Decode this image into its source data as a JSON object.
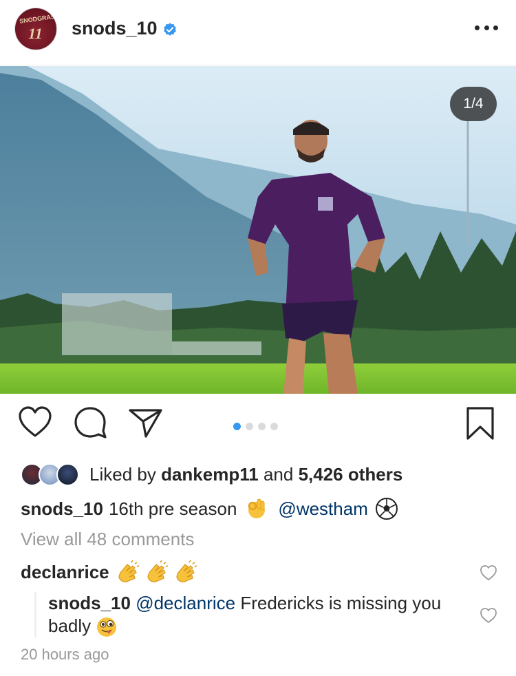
{
  "header": {
    "username": "snods_10",
    "avatar_shirt_text": "SNODGRASS",
    "avatar_shirt_number": "11",
    "verified_icon": "verified-badge-icon",
    "more_icon": "more-options-icon"
  },
  "photo": {
    "counter": "1/4"
  },
  "actions": {
    "like_icon": "heart-icon",
    "comment_icon": "comment-icon",
    "share_icon": "paper-plane-icon",
    "save_icon": "bookmark-icon",
    "carousel_total": 4,
    "carousel_active_index": 0
  },
  "likes": {
    "prefix": "Liked by",
    "first_liker": "dankemp11",
    "joiner": "and",
    "others": "5,426 others"
  },
  "caption": {
    "username": "snods_10",
    "text": "16th pre season",
    "mention": "@westham"
  },
  "view_all_comments": "View all 48 comments",
  "comments": [
    {
      "username": "declanrice"
    },
    {
      "username": "snods_10",
      "mention": "@declanrice",
      "text": "Fredericks is missing you badly"
    }
  ],
  "timestamp": "20 hours ago",
  "colors": {
    "accent_blue": "#3897f0",
    "mention_blue": "#003569",
    "text": "#262626",
    "muted": "#999999"
  }
}
